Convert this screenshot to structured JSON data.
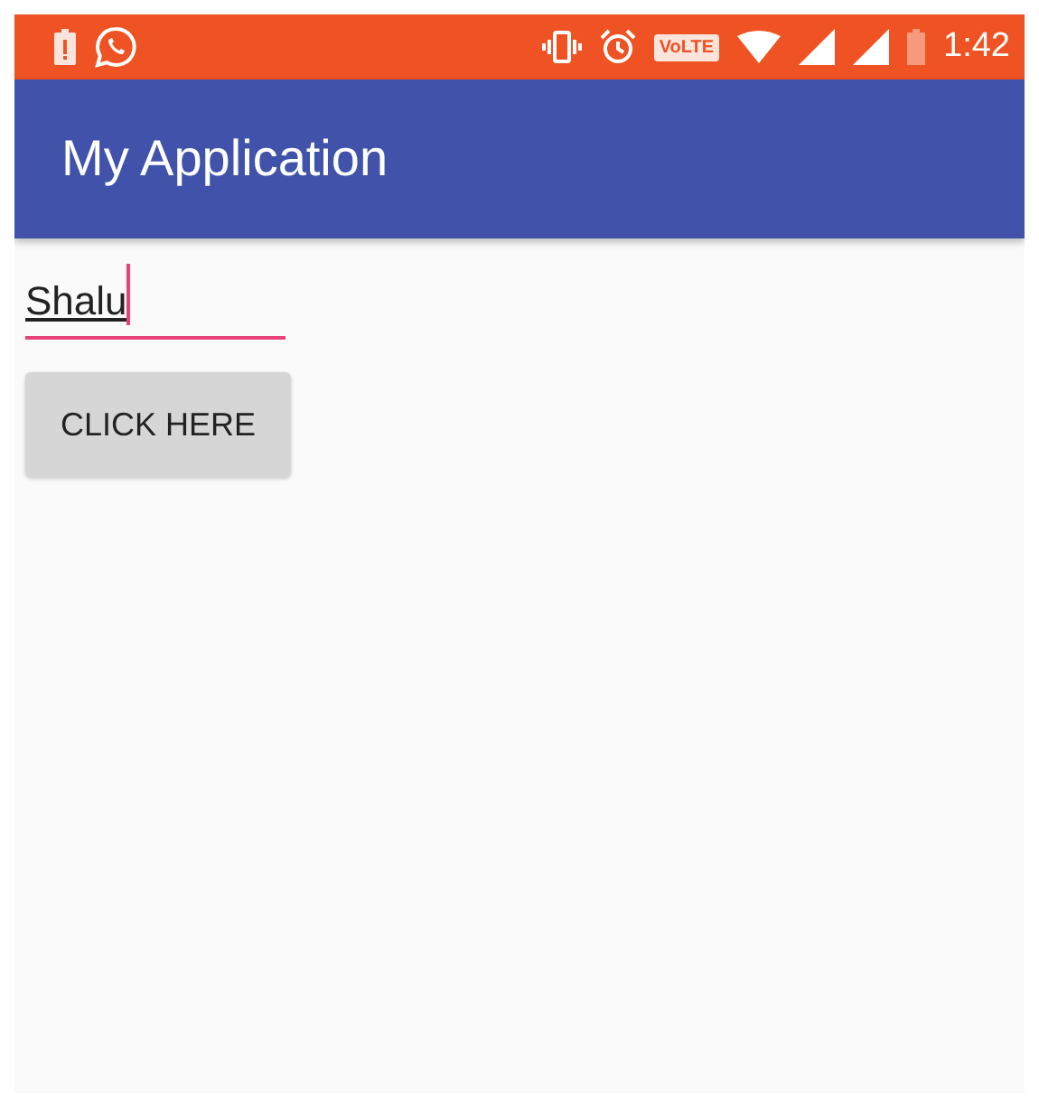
{
  "status_bar": {
    "volte": "VoLTE",
    "time": "1:42"
  },
  "app_bar": {
    "title": "My Application"
  },
  "name_field": {
    "value": "Shalu",
    "focused": true
  },
  "button": {
    "label": "CLICK HERE"
  }
}
